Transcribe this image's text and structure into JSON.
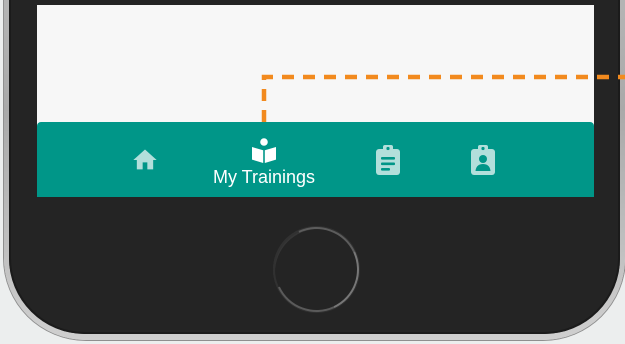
{
  "bottom_nav": {
    "items": [
      {
        "icon": "home-icon",
        "label": ""
      },
      {
        "icon": "book-reader-icon",
        "label": "My Trainings"
      },
      {
        "icon": "clipboard-list-icon",
        "label": ""
      },
      {
        "icon": "clipboard-user-icon",
        "label": ""
      }
    ]
  },
  "colors": {
    "nav_background": "#009688",
    "active_icon": "#ffffff",
    "inactive_icon": "#b2dfdb",
    "callout": "#f28a1e",
    "screen_background": "#f7f7f7",
    "device_body": "#242424"
  }
}
